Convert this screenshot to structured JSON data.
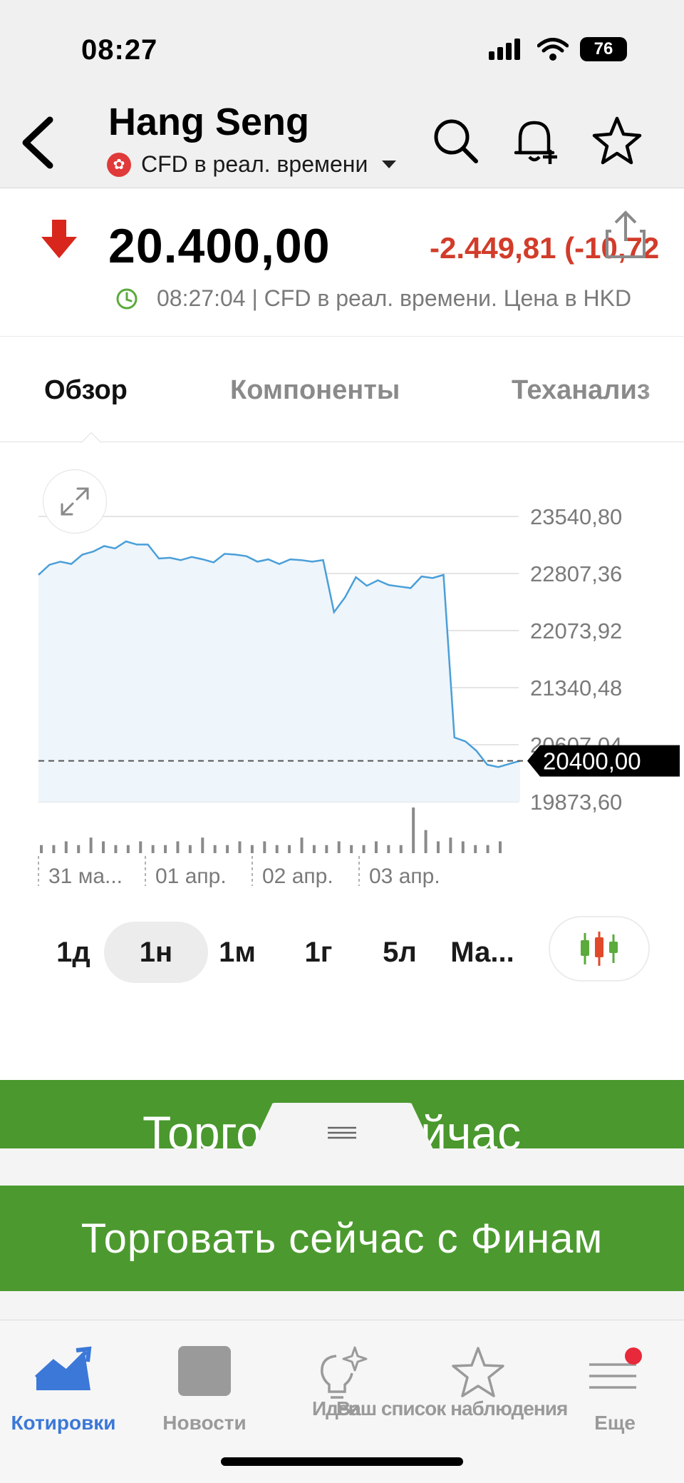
{
  "status_bar": {
    "time": "08:27",
    "battery": "76"
  },
  "header": {
    "title": "Hang Seng",
    "subtitle": "CFD в реал. времени",
    "icons": [
      "back-icon",
      "search-icon",
      "bell-plus-icon",
      "star-icon"
    ]
  },
  "quote": {
    "price": "20.400,00",
    "change": "-2.449,81 (-10,72",
    "meta": "08:27:04 | CFD в реал. времени. Цена в HKD",
    "direction": "down",
    "colors": {
      "down": "#d23c2a",
      "clock": "#5aaa3c"
    }
  },
  "tabs": [
    {
      "label": "Обзор",
      "active": true
    },
    {
      "label": "Компоненты",
      "active": false
    },
    {
      "label": "Теханализ",
      "active": false
    }
  ],
  "chart_data": {
    "type": "area",
    "y_ticks": [
      "23540,80",
      "22807,36",
      "22073,92",
      "21340,48",
      "20607,04",
      "19873,60"
    ],
    "ylim": [
      19873.6,
      23540.8
    ],
    "x_labels": [
      "31 ма...",
      "01 апр.",
      "02 апр.",
      "03 апр."
    ],
    "last_value_label": "20400,00",
    "last_value": 20400,
    "series_values": [
      22790,
      22920,
      22960,
      22930,
      23050,
      23090,
      23160,
      23130,
      23220,
      23180,
      23180,
      23000,
      23010,
      22980,
      23020,
      22990,
      22950,
      23060,
      23050,
      23030,
      22960,
      22990,
      22930,
      22990,
      22980,
      22960,
      22980,
      22310,
      22500,
      22760,
      22650,
      22720,
      22660,
      22640,
      22620,
      22770,
      22750,
      22790,
      20700,
      20650,
      20530,
      20350,
      20320,
      20360,
      20400
    ],
    "volume_values": [
      1,
      1,
      2,
      1,
      3,
      2,
      1,
      1,
      2,
      1,
      1,
      2,
      1,
      3,
      1,
      1,
      2,
      1,
      2,
      1,
      1,
      3,
      1,
      1,
      2,
      1,
      1,
      2,
      1,
      1,
      11,
      5,
      2,
      3,
      2,
      1,
      1,
      2
    ],
    "colors": {
      "line": "#4a9fd8",
      "fill": "#eef5fb",
      "grid": "#e4e4e4",
      "tag_bg": "#000000"
    }
  },
  "periods": [
    {
      "label": "1д",
      "active": false
    },
    {
      "label": "1н",
      "active": true
    },
    {
      "label": "1м",
      "active": false
    },
    {
      "label": "1г",
      "active": false
    },
    {
      "label": "5л",
      "active": false
    },
    {
      "label": "Ма...",
      "active": false
    }
  ],
  "chart_type_icon": "candlestick-icon",
  "banners": {
    "top_label": "Торговать сейчас",
    "bottom_label": "Торговать сейчас с Финам",
    "color": "#4a982e"
  },
  "tabbar": {
    "items": [
      {
        "label": "Котировки",
        "icon": "chart-trend-icon",
        "active": true
      },
      {
        "label": "Новости",
        "icon": "news-icon",
        "active": false
      },
      {
        "label": "Идеи",
        "icon": "lightbulb-icon",
        "active": false
      },
      {
        "label": "Ваш список наблюдения",
        "icon": "star-outline-icon",
        "active": false
      },
      {
        "label": "Еще",
        "icon": "menu-icon",
        "active": false
      }
    ],
    "active_color": "#3b78d8",
    "badge_color": "#e8293b"
  }
}
